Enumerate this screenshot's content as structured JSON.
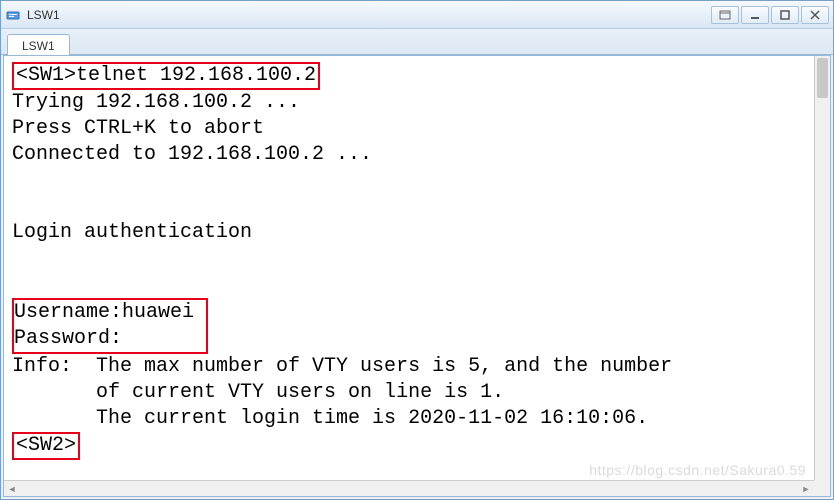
{
  "window": {
    "title": "LSW1"
  },
  "tabs": [
    {
      "label": "LSW1"
    }
  ],
  "terminal": {
    "cmd_line": "<SW1>telnet 192.168.100.2",
    "trying": "Trying 192.168.100.2 ...",
    "abort": "Press CTRL+K to abort",
    "connected": "Connected to 192.168.100.2 ...",
    "login_auth": "Login authentication",
    "username_line": "Username:huawei",
    "password_line": "Password:",
    "info1": "Info:  The max number of VTY users is 5, and the number",
    "info2": "       of current VTY users on line is 1.",
    "info3": "       The current login time is 2020-11-02 16:10:06.",
    "prompt2": "<SW2>"
  },
  "watermark": "https://blog.csdn.net/Sakura0.59"
}
